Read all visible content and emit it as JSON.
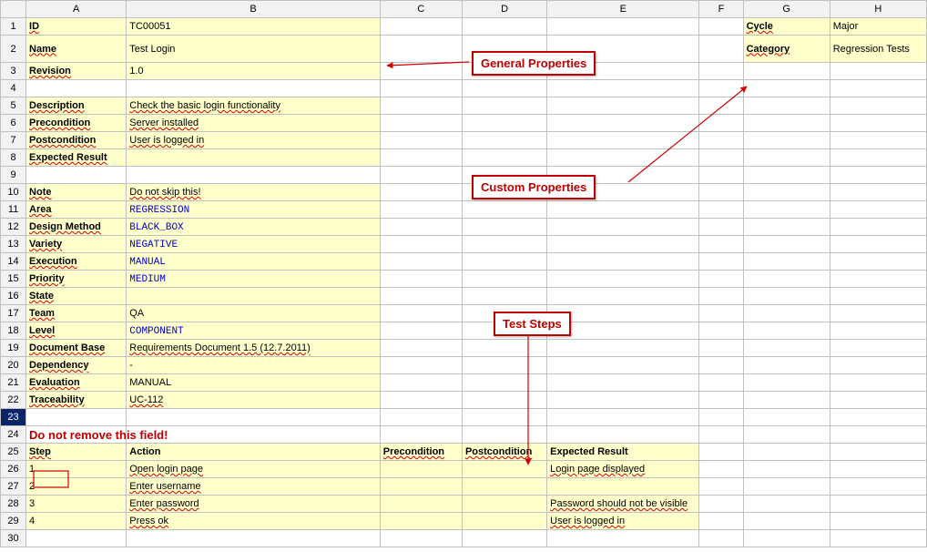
{
  "columns": [
    "A",
    "B",
    "C",
    "D",
    "E",
    "F",
    "G",
    "H"
  ],
  "rows": {
    "1": {
      "A_label": "ID",
      "B_value": "TC00051",
      "G_label": "Cycle",
      "H_value": "Major"
    },
    "2": {
      "A_label": "Name",
      "B_value": "Test Login",
      "G_label": "Category",
      "H_value": "Regression Tests"
    },
    "3": {
      "A_label": "Revision",
      "B_value": "1.0"
    },
    "5": {
      "A_label": "Description",
      "B_value": "Check the basic login functionality"
    },
    "6": {
      "A_label": "Precondition",
      "B_value": "Server installed"
    },
    "7": {
      "A_label": "Postcondition",
      "B_value": "User is logged in"
    },
    "8": {
      "A_label": "Expected Result",
      "B_value": ""
    },
    "10": {
      "A_label": "Note",
      "B_value": "Do not skip this!"
    },
    "11": {
      "A_label": "Area",
      "B_value": "REGRESSION"
    },
    "12": {
      "A_label": "Design Method",
      "B_value": "BLACK_BOX"
    },
    "13": {
      "A_label": "Variety",
      "B_value": "NEGATIVE"
    },
    "14": {
      "A_label": "Execution",
      "B_value": "MANUAL"
    },
    "15": {
      "A_label": "Priority",
      "B_value": "MEDIUM"
    },
    "16": {
      "A_label": "State",
      "B_value": ""
    },
    "17": {
      "A_label": "Team",
      "B_value": "QA"
    },
    "18": {
      "A_label": "Level",
      "B_value": "COMPONENT"
    },
    "19": {
      "A_label": "Document Base",
      "B_value": "Requirements Document 1.5 (12.7.2011)"
    },
    "20": {
      "A_label": "Dependency",
      "B_value": "-"
    },
    "21": {
      "A_label": "Evaluation",
      "B_value": "MANUAL"
    },
    "22": {
      "A_label": "Traceability",
      "B_value": "UC-112"
    }
  },
  "warning": "Do not remove this field!",
  "steps_header": {
    "step": "Step",
    "action": "Action",
    "pre": "Precondition",
    "post": "Postcondition",
    "exp": "Expected Result"
  },
  "steps": [
    {
      "n": "1",
      "action": "Open login page",
      "pre": "",
      "post": "",
      "exp": "Login page displayed"
    },
    {
      "n": "2",
      "action": "Enter username",
      "pre": "",
      "post": "",
      "exp": ""
    },
    {
      "n": "3",
      "action": "Enter password",
      "pre": "",
      "post": "",
      "exp": "Password should not be visible"
    },
    {
      "n": "4",
      "action": "Press ok",
      "pre": "",
      "post": "",
      "exp": "User is logged in"
    }
  ],
  "callouts": {
    "general": "General Properties",
    "custom": "Custom Properties",
    "teststeps": "Test Steps"
  }
}
